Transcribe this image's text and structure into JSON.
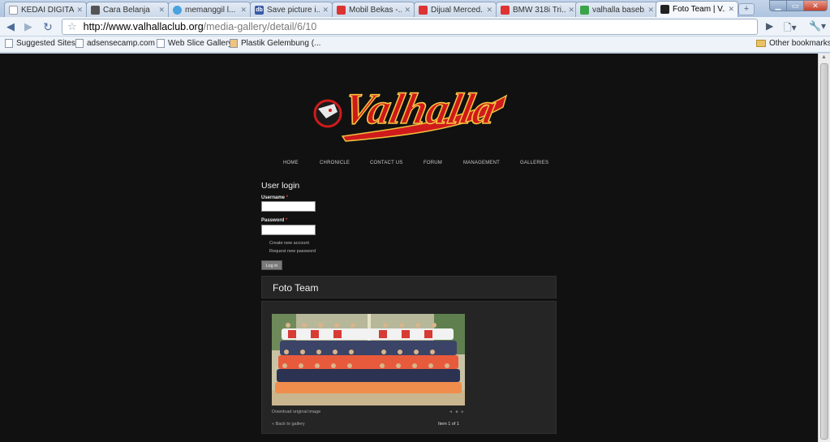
{
  "browser": {
    "tabs": [
      {
        "label": "KEDAI DIGITA...",
        "icon": "page-icon",
        "color": "#ffffff"
      },
      {
        "label": "Cara Belanja",
        "icon": "film-icon",
        "color": "#555555"
      },
      {
        "label": "memanggil l...",
        "icon": "globe-icon",
        "color": "#4aa3df"
      },
      {
        "label": "Save picture i...",
        "icon": "db-icon",
        "color": "#3a5aa8"
      },
      {
        "label": "Mobil Bekas -...",
        "icon": "car-icon",
        "color": "#d33333"
      },
      {
        "label": "Dijual Merced...",
        "icon": "car-icon",
        "color": "#d33333"
      },
      {
        "label": "BMW 318i Tri...",
        "icon": "car-icon",
        "color": "#d33333"
      },
      {
        "label": "valhalla baseb...",
        "icon": "google-icon",
        "color": "#3aa548"
      },
      {
        "label": "Foto Team | V...",
        "icon": "valhalla-icon",
        "color": "#222222",
        "active": true
      }
    ],
    "new_tab_label": "+",
    "address": {
      "host": "http://www.valhallaclub.org",
      "path": "/media-gallery/detail/6/10"
    },
    "bookmarks": [
      {
        "label": "Suggested Sites"
      },
      {
        "label": "adsensecamp.com"
      },
      {
        "label": "Web Slice Gallery"
      },
      {
        "label": "Plastik Gelembung (..."
      }
    ],
    "other_bookmarks": "Other bookmarks"
  },
  "site": {
    "logo_text": "Valhalla",
    "nav": [
      "HOME",
      "CHRONICLE",
      "CONTACT US",
      "FORUM",
      "MANAGEMENT",
      "GALLERIES"
    ],
    "login": {
      "title": "User login",
      "username_label": "Username",
      "password_label": "Password",
      "required_mark": "*",
      "create_account": "Create new account",
      "request_password": "Request new password",
      "submit": "Log in"
    },
    "gallery": {
      "title": "Foto Team",
      "download": "Download original image",
      "controls": "◄ ■ ►",
      "back": "« Back to gallery",
      "count": "Item 1 of 1"
    }
  },
  "colors": {
    "accent_red": "#cf1b1b",
    "page_bg": "#111111",
    "panel_bg": "#252525"
  }
}
